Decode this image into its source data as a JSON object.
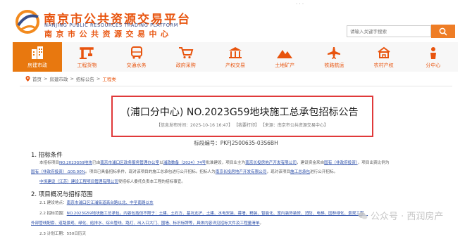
{
  "header": {
    "logo_cn": "南京市公共资源交易平台",
    "logo_en": "NANJING PUBLIC RESOURCES TRADING PLATFORM",
    "logo_cn2": "南京市公共资源交易中心",
    "top_links": "· · ·",
    "search_placeholder": "请输入关键字搜索"
  },
  "nav": [
    {
      "label": "房建市政",
      "icon": "building-icon"
    },
    {
      "label": "工程货物",
      "icon": "crane-icon"
    },
    {
      "label": "交通水务",
      "icon": "bus-icon"
    },
    {
      "label": "政府采购",
      "icon": "cart-icon"
    },
    {
      "label": "产权交易",
      "icon": "bank-icon"
    },
    {
      "label": "土地矿产",
      "icon": "mountain-icon"
    },
    {
      "label": "铁路航运",
      "icon": "plane-icon"
    },
    {
      "label": "农村产权",
      "icon": "farm-icon"
    },
    {
      "label": "分中心",
      "icon": "person-icon"
    }
  ],
  "breadcrumb": {
    "home": "首页",
    "sep": ">",
    "level1": "房建市政",
    "level2": "招标公告",
    "current": "工程类"
  },
  "notice": {
    "title": "(浦口分中心) NO.2023G59地块施工总承包招标公告",
    "meta": "【信息发布时间：2025-10-16 16:47】 【我要打印】 【来源：南京市公共资源交易中心】",
    "bianhao_label": "标段编号：",
    "bianhao_value": "PKFJ2500635-03S6BH"
  },
  "content": {
    "s1_title": "1. 招标条件",
    "s1_p1a": "本招标项目",
    "s1_p1_link1": "NO.2023G59地块",
    "s1_p1b": "已由",
    "s1_p1_link2": "南京市浦口区政务服务管理办公室",
    "s1_p1c": "以",
    "s1_p1_link3": "浦政数备（2024）74号",
    "s1_p1d": "批准建设，项目业主为",
    "s1_p1_link4": "南京长投房地产开发有限公司",
    "s1_p1e": "，建设资金来自",
    "s1_p1_link5": "国有（非政府投资）",
    "s1_p1f": "，项目出资比例为",
    "s1_p2_link1": "国有（非政府投资）:100.00%",
    "s1_p2a": "。项目已具备招标条件，现对该项目的施工总承包进行公开招标。招标人为",
    "s1_p2_link2": "南京长投房地产开发有限公司",
    "s1_p2b": "，现对该项目",
    "s1_p2_link3": "施工总承包",
    "s1_p2c": "进行公开招标。",
    "s1_p3_link": "中恒建设（江苏）建设工程项目管理有限公司",
    "s1_p3": "受招标人委托负责本工程的招标事宜。",
    "s2_title": "2. 项目概况与招标范围",
    "s2_p1a": "2.1 建设地点：",
    "s2_p1_link": "南京市浦口区江浦街道高台路以北、中圣南路以东",
    "s2_p2a": "2.2 招标范围：",
    "s2_p2_link": "NO.2023G59地块施工总承包，内容包括但不限于：土建、土石方、基坑支护、土建、水电安装、幕墙、精装、智能化、室内装饰装修、",
    "s2_p2_tail": "消防、电梯、园林绿化、景观工程、",
    "s2_p3_link": "外部管线配套、道路景观、绿化、给排水、综合管线、路灯、出入口大门、围墙、标识标牌等，具体内容详见招标文件及工程量清单",
    "s2_p3": "。",
    "s2_p4": "2.3 计划工期：550日历天"
  },
  "watermark": "公众号 · 西润房产"
}
